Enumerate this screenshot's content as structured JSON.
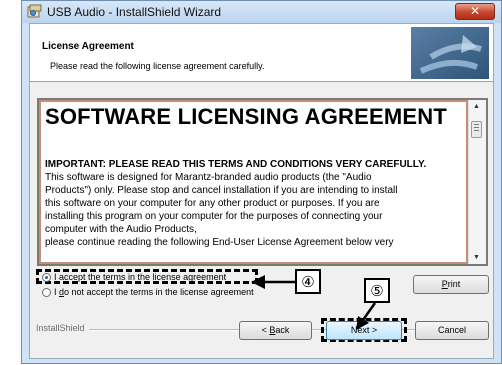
{
  "window": {
    "title": "USB Audio - InstallShield Wizard",
    "close_label": "✕"
  },
  "header": {
    "title": "License Agreement",
    "subtitle": "Please read the following license agreement carefully."
  },
  "license": {
    "heading": "SOFTWARE LICENSING AGREEMENT",
    "important": "IMPORTANT: PLEASE READ THIS TERMS AND CONDITIONS VERY CAREFULLY.",
    "lines": [
      "This software is designed for Marantz-branded audio products (the \"Audio",
      "Products\") only. Please stop and cancel installation if you are intending to install",
      "this software on your computer for any other product or purposes. If you are",
      "installing this program on your computer for the purposes of connecting your",
      "computer with the Audio Products,",
      "please continue reading the following End-User License Agreement below very"
    ]
  },
  "options": {
    "accept": {
      "underline": "I",
      "rest": " accept the terms in the license agreement",
      "selected": true
    },
    "decline": {
      "pre": "I ",
      "underline": "d",
      "rest": "o not accept the terms in the license agreement",
      "selected": false
    }
  },
  "buttons": {
    "print": {
      "underline": "P",
      "rest": "rint"
    },
    "back": {
      "pre": "< ",
      "underline": "B",
      "rest": "ack"
    },
    "next": "Next >",
    "cancel": "Cancel"
  },
  "footer": {
    "brand": "InstallShield"
  },
  "callouts": {
    "four": "④",
    "five": "⑤"
  },
  "colors": {
    "title_bar": "#c9ddf4",
    "close_button": "#c8452d",
    "dialog_bg": "#f0f0f0",
    "next_button": "#bee6fd"
  }
}
